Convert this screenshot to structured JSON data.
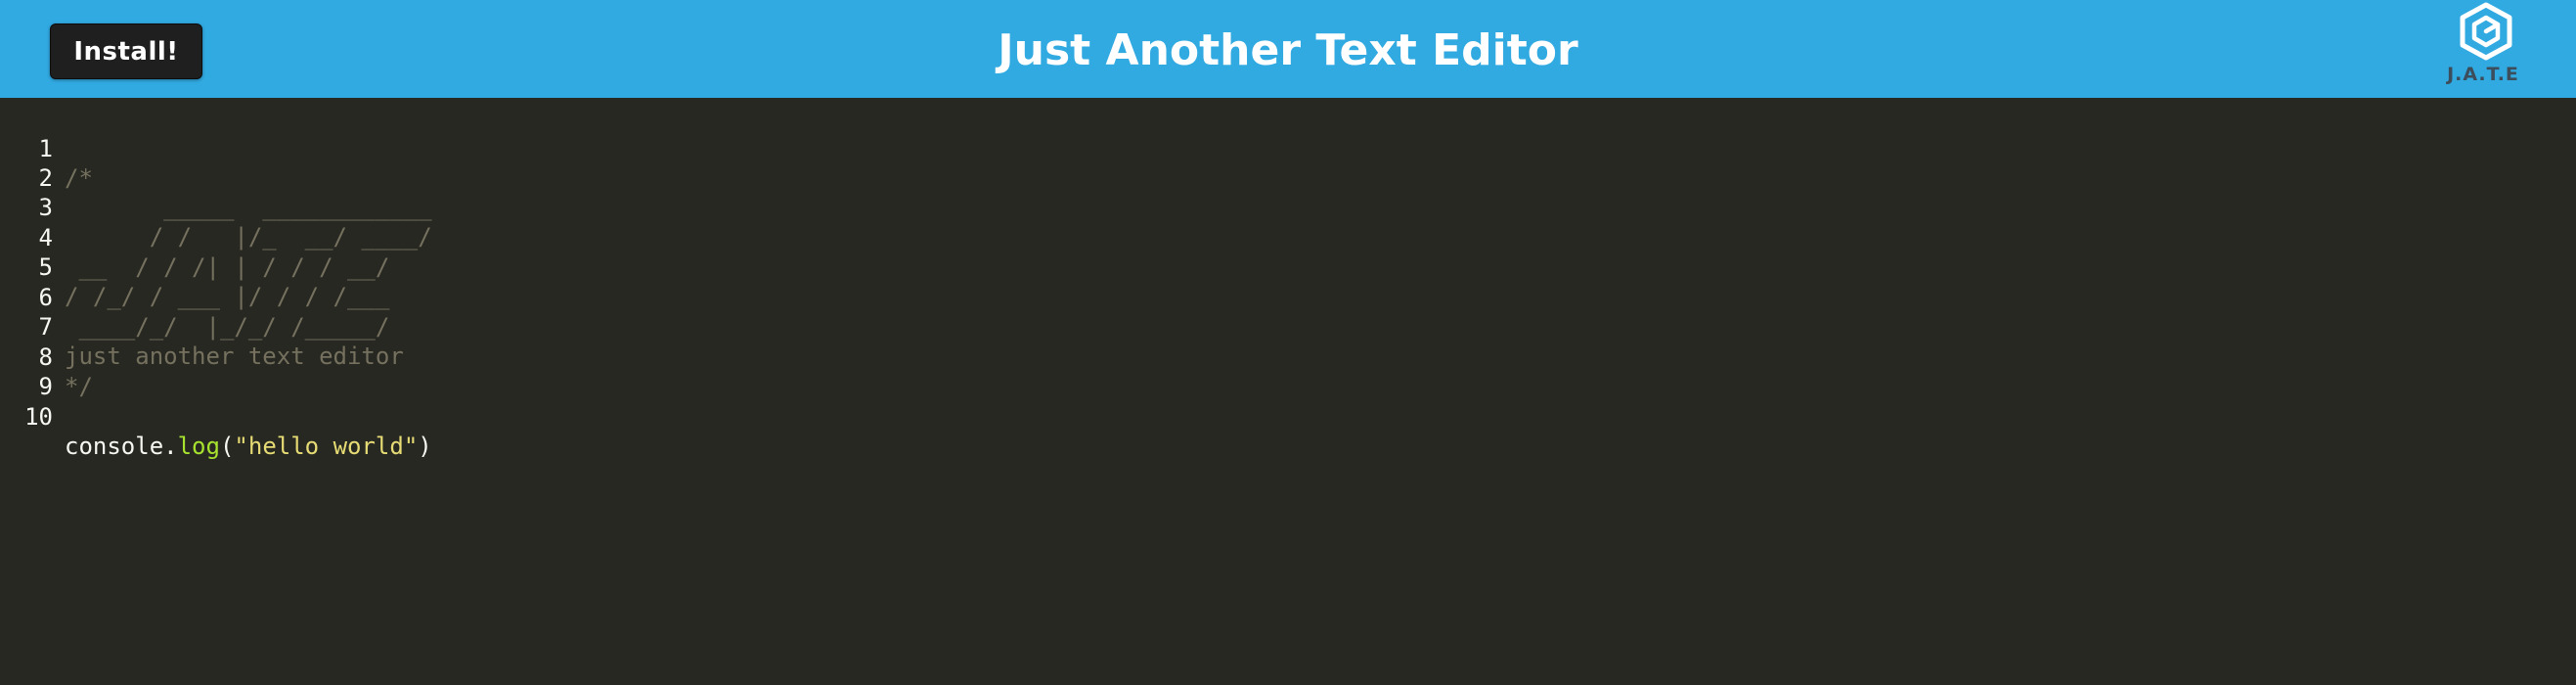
{
  "header": {
    "install_label": "Install!",
    "title": "Just Another Text Editor",
    "logo_text": "J.A.T.E",
    "logo_icon": "hexagon-logo-icon",
    "background_color": "#31a9e1"
  },
  "editor": {
    "theme": {
      "background": "#272822",
      "comment": "#75715e",
      "text": "#f8f8f2",
      "function": "#a6e22e",
      "string": "#e6db74"
    },
    "line_numbers": [
      "1",
      "2",
      "3",
      "4",
      "5",
      "6",
      "7",
      "8",
      "9",
      "10"
    ],
    "comment_lines": [
      "/*",
      "       _____  ____________",
      "      / /   |/_  __/ ____/",
      " __  / / /| | / / / __/",
      "/ /_/ / ___ |/ / / /___",
      " ____/_/  |_/_/ /_____/",
      "just another text editor",
      "*/",
      ""
    ],
    "code_line": {
      "object": "console",
      "dot": ".",
      "method": "log",
      "open_paren": "(",
      "string_arg": "\"hello world\"",
      "close_paren": ")"
    }
  }
}
